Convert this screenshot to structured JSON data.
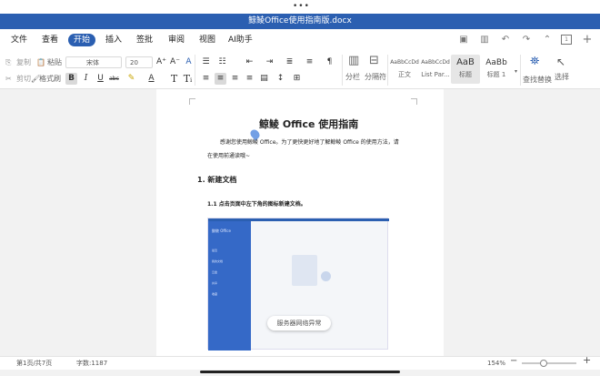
{
  "titlebar": {
    "title": "鲸鲮Office使用指南版.docx"
  },
  "menu": [
    {
      "label": "文件"
    },
    {
      "label": "查看"
    },
    {
      "label": "开始"
    },
    {
      "label": "插入"
    },
    {
      "label": "签批"
    },
    {
      "label": "审阅"
    },
    {
      "label": "视图"
    },
    {
      "label": "AI助手"
    }
  ],
  "active_menu": "开始",
  "toolbar": {
    "copy": "复制",
    "paste": "粘贴",
    "cut": "剪切",
    "format_painter": "格式刷",
    "font_name": "宋体",
    "font_size": "20",
    "bold": "B",
    "italic": "I",
    "underline": "U",
    "strike": "abc",
    "column": "分栏",
    "page_break": "分隔符",
    "styles": [
      {
        "preview": "AaBbCcDd",
        "name": "正文"
      },
      {
        "preview": "AaBbCcDd",
        "name": "List Par..."
      },
      {
        "preview": "AaB",
        "name": "标题"
      },
      {
        "preview": "AaBb",
        "name": "标题 1"
      }
    ],
    "find_replace": "查找替换",
    "select": "选择"
  },
  "document": {
    "title": "鲸鲮 Office 使用指南",
    "intro_line1": "感谢您使用鲸鲮 Office。为了更快更好地了解鲸鲮 Office 的使用方法，请",
    "intro_line2": "在使用前通读哦~",
    "heading1": "1. 新建文档",
    "heading1_1": "1.1 点击页面中左下角的图标新建文档。",
    "screenshot": {
      "app_name": "鲸鲮 Office",
      "sidebar_items": [
        "最近",
        "我的文档",
        "云盘",
        "共享",
        "收藏"
      ],
      "toast": "服务器网络异常"
    }
  },
  "status": {
    "page": "第1页/共7页",
    "words": "字数:1187",
    "zoom": "154%"
  }
}
